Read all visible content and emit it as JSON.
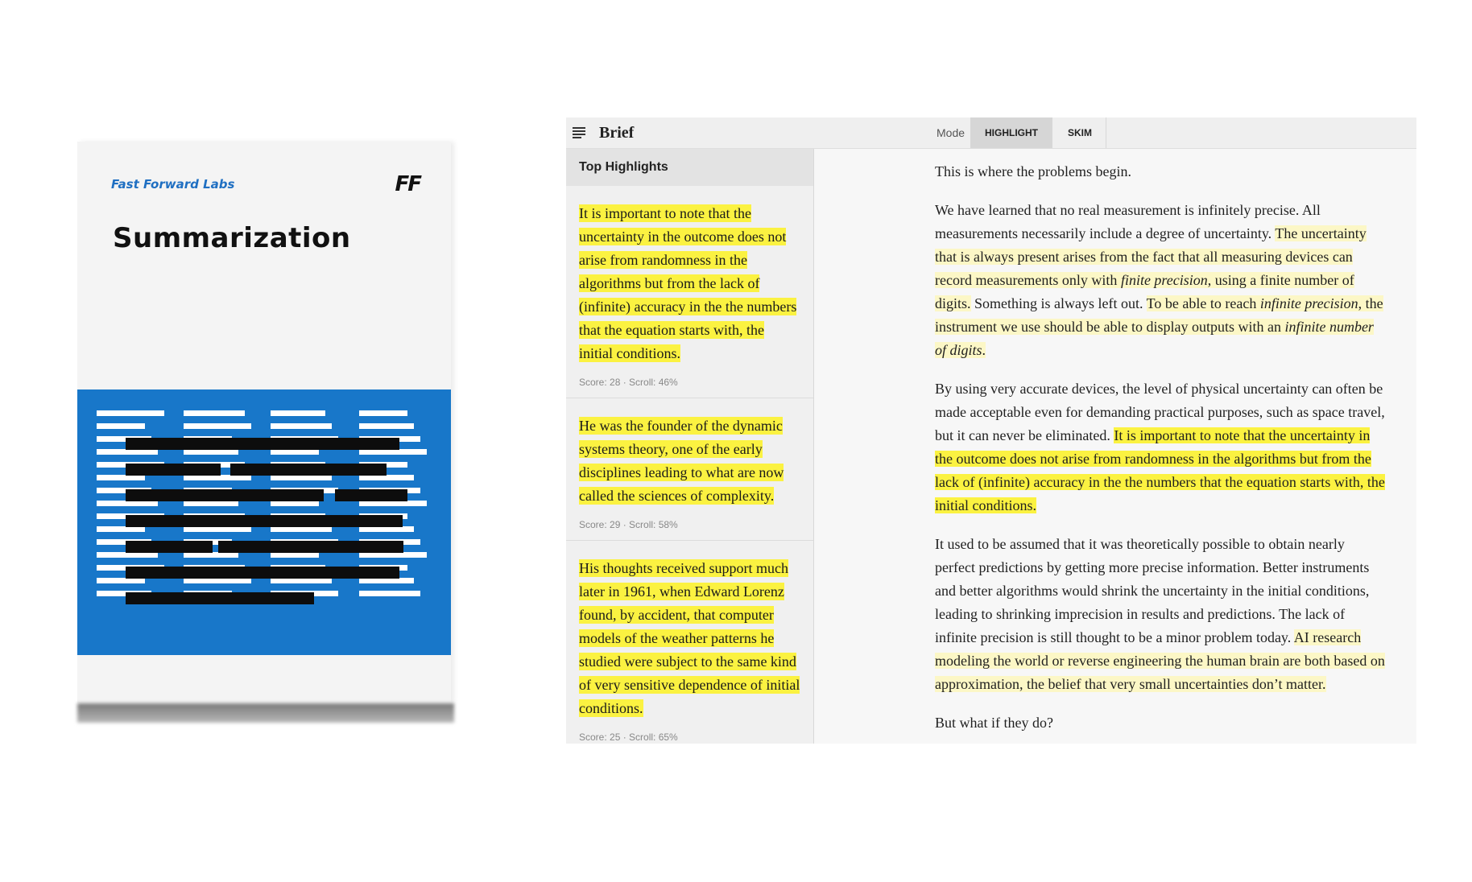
{
  "book": {
    "brand": "Fast Forward Labs",
    "logo": "FF",
    "title": "Summarization",
    "accent_color": "#1877c9"
  },
  "app": {
    "title": "Brief",
    "mode_label": "Mode",
    "modes": [
      {
        "label": "HIGHLIGHT",
        "active": true
      },
      {
        "label": "SKIM",
        "active": false
      }
    ]
  },
  "sidebar": {
    "header": "Top Highlights",
    "cards": [
      {
        "text": "It is important to note that the uncertainty in the outcome does not arise from randomness in the algorithms but from the lack of (infinite) accuracy in the the numbers that the equation starts with, the initial conditions.",
        "meta": "Score: 28 · Scroll: 46%"
      },
      {
        "text": "He was the founder of the dynamic systems theory, one of the early disciplines leading to what are now called the sciences of complexity.",
        "meta": "Score: 29 · Scroll: 58%"
      },
      {
        "text": "His thoughts received support much later in 1961, when Edward Lorenz found, by accident, that computer models of the weather patterns he studied were subject to the same kind of very sensitive dependence of initial conditions.",
        "meta": "Score: 25 · Scroll: 65%"
      }
    ]
  },
  "reader": {
    "p1": "This is where the problems begin.",
    "p2": {
      "plain1": "We have learned that no real measurement is infinitely precise. All measurements necessarily include a degree of uncertainty. ",
      "soft1_a": "The uncertainty that is always present arises from the fact that all measuring devices can record measurements only with ",
      "soft1_i": "finite precision",
      "soft1_b": ", using a finite number of digits.",
      "plain2": " Something is always left out. ",
      "soft2_a": "To be able to reach ",
      "soft2_i1": "infinite precision",
      "soft2_b": ", the instrument we use should be able to display outputs with an ",
      "soft2_i2": "infinite number of digits",
      "soft2_c": "."
    },
    "p3": {
      "plain": "By using very accurate devices, the level of physical uncertainty can often be made acceptable even for demanding practical purposes, such as space travel, but it can never be eliminated. ",
      "strong": "It is important to note that the uncertainty in the outcome does not arise from randomness in the algorithms but from the lack of (infinite) accuracy in the the numbers that the equation starts with, the initial conditions."
    },
    "p4": {
      "plain": "It used to be assumed that it was theoretically possible to obtain nearly perfect predictions by getting more precise information. Better instruments and better algorithms would shrink the uncertainty in the initial conditions, leading to shrinking imprecision in results and predictions. The lack of infinite precision is still thought to be a minor problem today. ",
      "soft": "AI research modeling the world or reverse engineering the human brain are both based on approximation, the belief that very small uncertainties don’t matter."
    },
    "p5": "But what if they do?"
  }
}
